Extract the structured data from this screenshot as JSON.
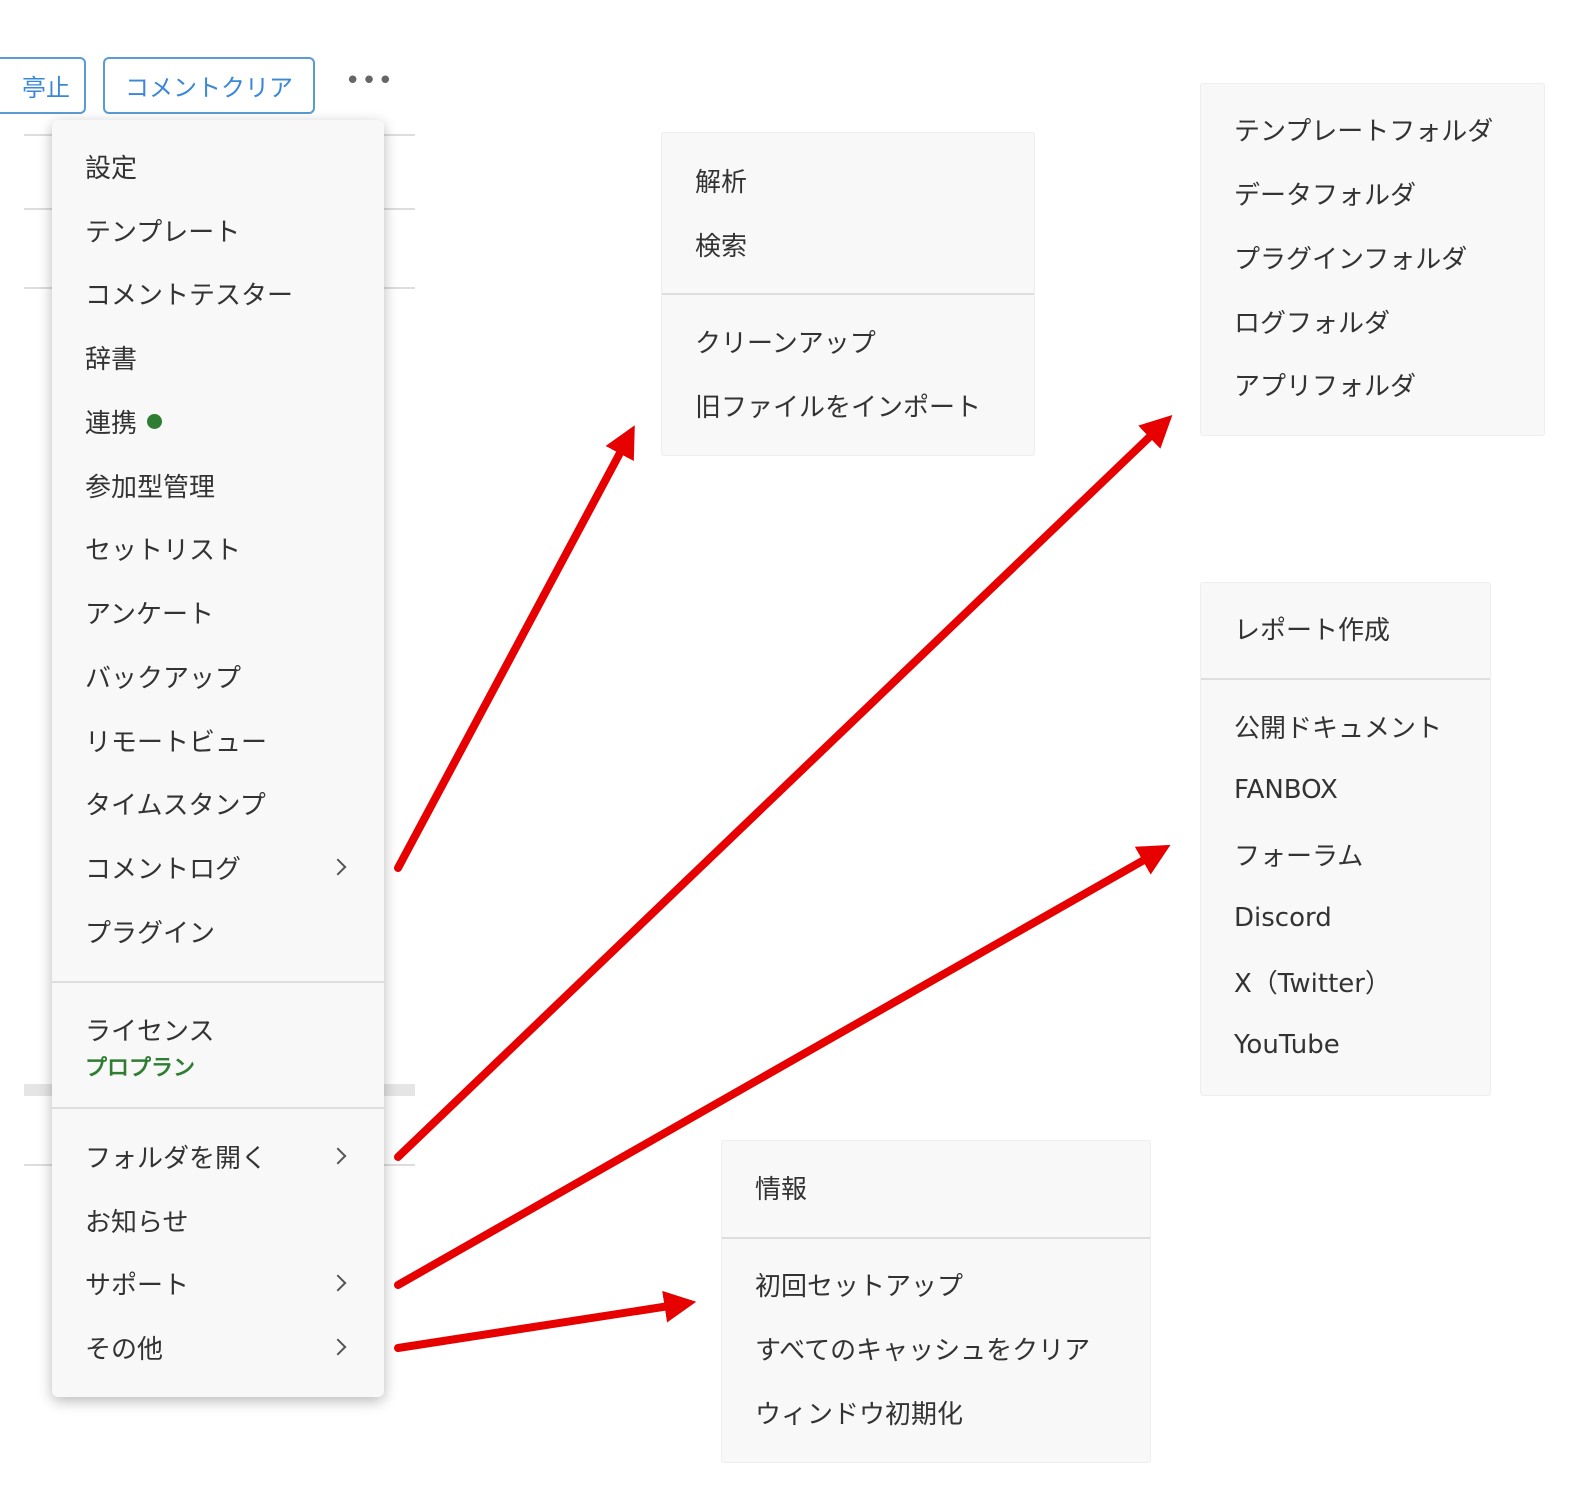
{
  "toolbar": {
    "stop_button": "停止",
    "stop_button_visible": "亭止",
    "comment_clear_button": "コメントクリア",
    "more_button": "•••"
  },
  "main_menu": {
    "group1": [
      "設定",
      "テンプレート",
      "コメントテスター",
      "辞書",
      "連携",
      "参加型管理",
      "セットリスト",
      "アンケート",
      "バックアップ",
      "リモートビュー",
      "タイムスタンプ",
      "コメントログ",
      "プラグイン"
    ],
    "license_label": "ライセンス",
    "license_plan": "プロプラン",
    "group3": [
      "フォルダを開く",
      "お知らせ",
      "サポート",
      "その他"
    ]
  },
  "comment_log_submenu": {
    "group1": [
      "解析",
      "検索"
    ],
    "group2": [
      "クリーンアップ",
      "旧ファイルをインポート"
    ]
  },
  "folder_submenu": {
    "items": [
      "テンプレートフォルダ",
      "データフォルダ",
      "プラグインフォルダ",
      "ログフォルダ",
      "アプリフォルダ"
    ]
  },
  "support_submenu": {
    "group1": [
      "レポート作成"
    ],
    "group2": [
      "公開ドキュメント",
      "FANBOX",
      "フォーラム",
      "Discord",
      "X（Twitter）",
      "YouTube"
    ]
  },
  "other_submenu": {
    "group1": [
      "情報"
    ],
    "group2": [
      "初回セットアップ",
      "すべてのキャッシュをクリア",
      "ウィンドウ初期化"
    ]
  },
  "colors": {
    "status_dot": "#2e7d32",
    "plan_text": "#2e7d32",
    "arrow": "#e60000",
    "button_border": "#5b9bd5",
    "button_text": "#3a87d8"
  }
}
